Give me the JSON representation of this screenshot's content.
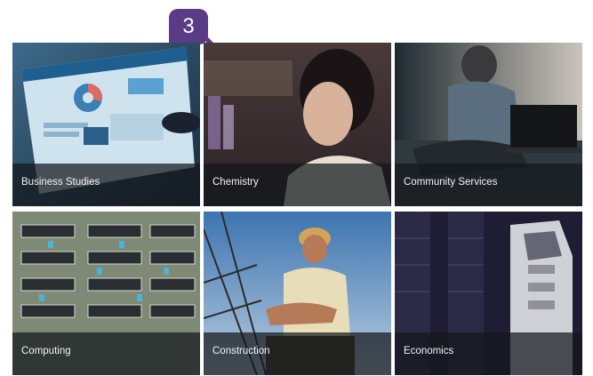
{
  "badge": {
    "label": "3"
  },
  "colors": {
    "badge": "#5b3b86",
    "caption_bar": "#14181c"
  },
  "tiles": [
    {
      "label": "Business Studies",
      "icon": "tablet-dashboard-photo"
    },
    {
      "label": "Chemistry",
      "icon": "lab-researcher-photo"
    },
    {
      "label": "Community Services",
      "icon": "person-with-laptop-photo"
    },
    {
      "label": "Computing",
      "icon": "circuit-board-chips-photo"
    },
    {
      "label": "Construction",
      "icon": "construction-worker-photo"
    },
    {
      "label": "Economics",
      "icon": "skyscrapers-photo"
    }
  ]
}
